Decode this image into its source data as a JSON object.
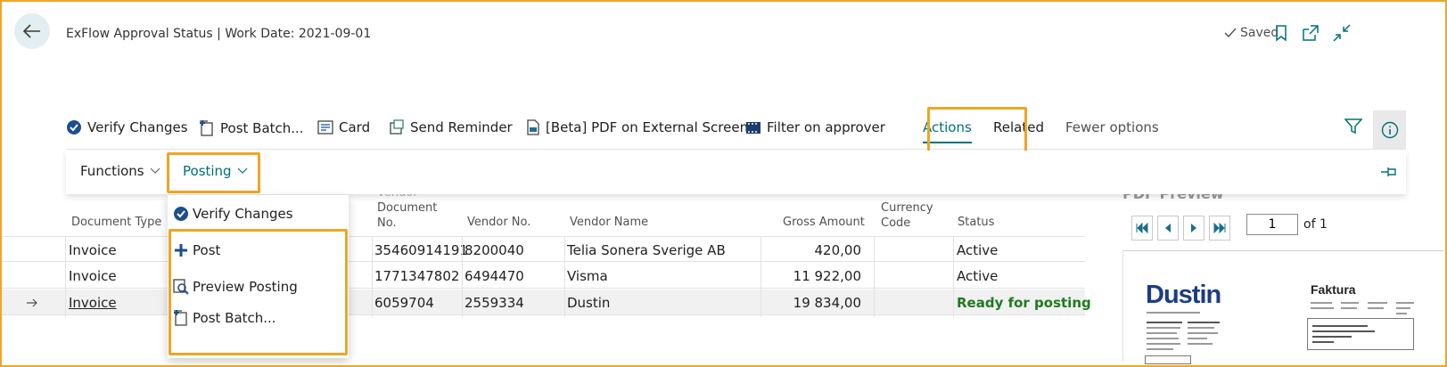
{
  "header": {
    "title": "ExFlow Approval Status | Work Date: 2021-09-01",
    "saved_label": "Saved"
  },
  "actionbar": {
    "verify_changes": "Verify Changes",
    "post_batch": "Post Batch...",
    "card": "Card",
    "send_reminder": "Send Reminder",
    "pdf_external": "[Beta] PDF on External Screen",
    "filter_on_approver": "Filter on approver",
    "tab_actions": "Actions",
    "tab_related": "Related",
    "tab_fewer": "Fewer options"
  },
  "subbar": {
    "functions": "Functions",
    "posting": "Posting"
  },
  "posting_menu": {
    "items": [
      "Verify Changes",
      "Post",
      "Preview Posting",
      "Post Batch..."
    ]
  },
  "table": {
    "columns": {
      "document_type": "Document Type",
      "sort_indicator": "↑",
      "vendor_document_no_line1": "Vendor",
      "vendor_document_no_line2": "Document",
      "vendor_document_no_line3": "No.",
      "vendor_no": "Vendor No.",
      "vendor_name": "Vendor Name",
      "gross_amount": "Gross Amount",
      "currency_code_line1": "Currency",
      "currency_code_line2": "Code",
      "status": "Status"
    },
    "rows": [
      {
        "document_type": "Invoice",
        "vendor_document_no": "35460914191",
        "vendor_no": "8200040",
        "vendor_name": "Telia Sonera Sverige AB",
        "gross_amount": "420,00",
        "currency_code": "",
        "status": "Active"
      },
      {
        "document_type": "Invoice",
        "vendor_document_no": "1771347802",
        "vendor_no": "6494470",
        "vendor_name": "Visma",
        "gross_amount": "11 922,00",
        "currency_code": "",
        "status": "Active"
      },
      {
        "document_type": "Invoice",
        "vendor_document_no": "6059704",
        "vendor_no": "2559334",
        "vendor_name": "Dustin",
        "gross_amount": "19 834,00",
        "currency_code": "",
        "status": "Ready for posting"
      }
    ]
  },
  "pdf_preview": {
    "title": "PDF Preview",
    "page_value": "1",
    "of_label": "of 1",
    "logo_text": "Dustin",
    "doc_heading": "Faktura"
  },
  "colors": {
    "accent": "#00707a",
    "highlight": "#f0a524",
    "ready": "#1f7a1f"
  }
}
